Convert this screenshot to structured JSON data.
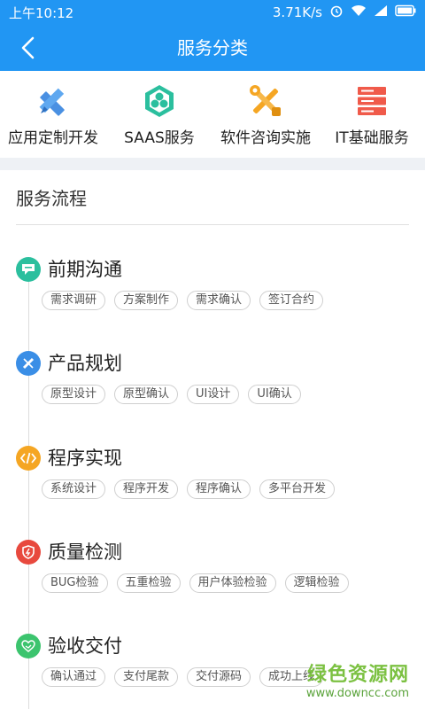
{
  "status": {
    "time": "上午10:12",
    "speed": "3.71K/s"
  },
  "header": {
    "title": "服务分类"
  },
  "categories": [
    {
      "label": "应用定制开发",
      "icon": "pencil-ruler-icon"
    },
    {
      "label": "SAAS服务",
      "icon": "hexagon-cluster-icon"
    },
    {
      "label": "软件咨询实施",
      "icon": "tools-icon"
    },
    {
      "label": "IT基础服务",
      "icon": "server-icon"
    }
  ],
  "section": {
    "title": "服务流程"
  },
  "steps": [
    {
      "title": "前期沟通",
      "color": "#2bbf9e",
      "icon": "chat-icon",
      "tags": [
        "需求调研",
        "方案制作",
        "需求确认",
        "签订合约"
      ]
    },
    {
      "title": "产品规划",
      "color": "#3a8ee6",
      "icon": "pencil-ruler-icon",
      "tags": [
        "原型设计",
        "原型确认",
        "UI设计",
        "UI确认"
      ]
    },
    {
      "title": "程序实现",
      "color": "#f5a623",
      "icon": "code-icon",
      "tags": [
        "系统设计",
        "程序开发",
        "程序确认",
        "多平台开发"
      ]
    },
    {
      "title": "质量检测",
      "color": "#e8493e",
      "icon": "shield-icon",
      "tags": [
        "BUG检验",
        "五重检验",
        "用户体验检验",
        "逻辑检验"
      ]
    },
    {
      "title": "验收交付",
      "color": "#3cc46e",
      "icon": "handshake-icon",
      "tags": [
        "确认通过",
        "支付尾款",
        "交付源码",
        "成功上线"
      ]
    }
  ],
  "watermark": {
    "main": "绿色资源网",
    "sub": "www.downcc.com"
  },
  "colors": {
    "primary": "#2196f3"
  }
}
